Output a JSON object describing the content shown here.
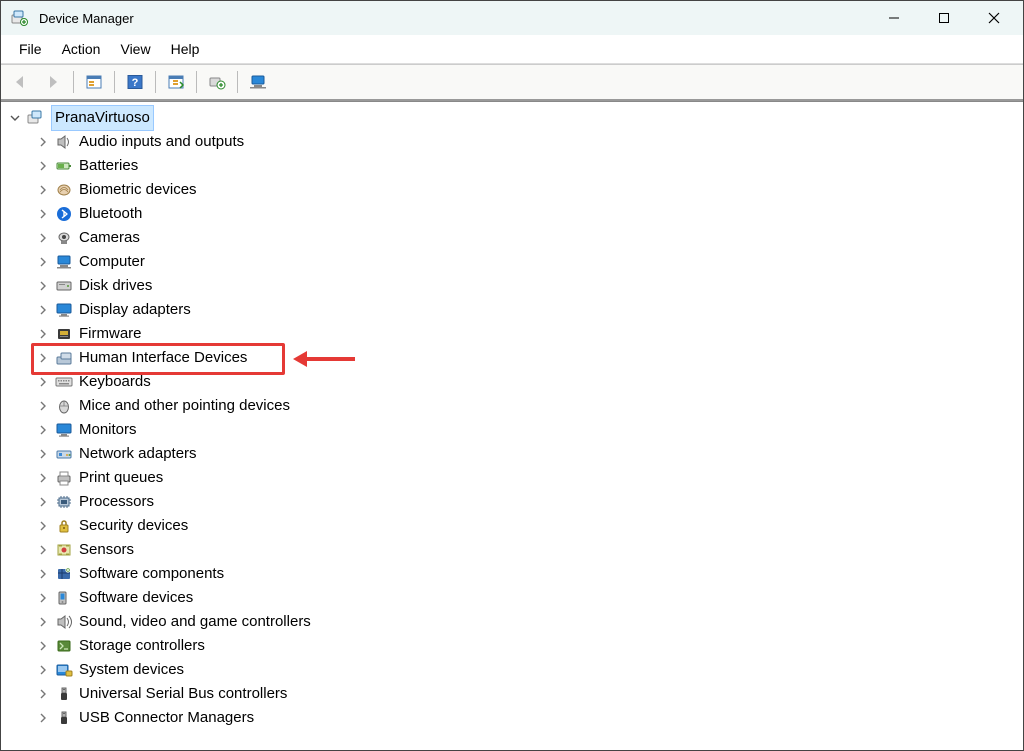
{
  "window": {
    "title": "Device Manager"
  },
  "menus": {
    "file": "File",
    "action": "Action",
    "view": "View",
    "help": "Help"
  },
  "root": {
    "name": "PranaVirtuoso"
  },
  "categories": [
    {
      "id": "audio",
      "label": "Audio inputs and outputs"
    },
    {
      "id": "batteries",
      "label": "Batteries"
    },
    {
      "id": "biometric",
      "label": "Biometric devices"
    },
    {
      "id": "bluetooth",
      "label": "Bluetooth"
    },
    {
      "id": "cameras",
      "label": "Cameras"
    },
    {
      "id": "computer",
      "label": "Computer"
    },
    {
      "id": "disk",
      "label": "Disk drives"
    },
    {
      "id": "display",
      "label": "Display adapters"
    },
    {
      "id": "firmware",
      "label": "Firmware"
    },
    {
      "id": "hid",
      "label": "Human Interface Devices",
      "highlighted": true
    },
    {
      "id": "keyboards",
      "label": "Keyboards"
    },
    {
      "id": "mice",
      "label": "Mice and other pointing devices"
    },
    {
      "id": "monitors",
      "label": "Monitors"
    },
    {
      "id": "network",
      "label": "Network adapters"
    },
    {
      "id": "print",
      "label": "Print queues"
    },
    {
      "id": "processors",
      "label": "Processors"
    },
    {
      "id": "security",
      "label": "Security devices"
    },
    {
      "id": "sensors",
      "label": "Sensors"
    },
    {
      "id": "swcomp",
      "label": "Software components"
    },
    {
      "id": "swdev",
      "label": "Software devices"
    },
    {
      "id": "sound",
      "label": "Sound, video and game controllers"
    },
    {
      "id": "storage",
      "label": "Storage controllers"
    },
    {
      "id": "system",
      "label": "System devices"
    },
    {
      "id": "usb",
      "label": "Universal Serial Bus controllers"
    },
    {
      "id": "usbconn",
      "label": "USB Connector Managers"
    }
  ]
}
